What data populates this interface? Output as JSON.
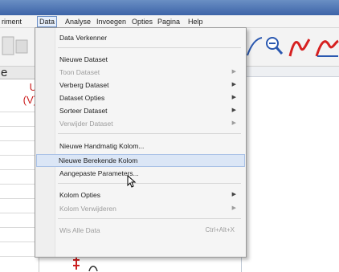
{
  "menubar": {
    "items": [
      {
        "id": "experiment",
        "label": "riment"
      },
      {
        "id": "data",
        "label": "Data"
      },
      {
        "id": "analyse",
        "label": "Analyse"
      },
      {
        "id": "invoegen",
        "label": "Invoegen"
      },
      {
        "id": "opties",
        "label": "Opties"
      },
      {
        "id": "pagina",
        "label": "Pagina"
      },
      {
        "id": "help",
        "label": "Help"
      }
    ]
  },
  "left_panel": {
    "header": "e",
    "label_line1": "U",
    "label_line2": "(V)"
  },
  "data_menu": {
    "items": [
      {
        "label": "Data Verkenner",
        "enabled": true,
        "submenu": false
      },
      {
        "label": "Nieuwe Dataset",
        "enabled": true,
        "submenu": false
      },
      {
        "label": "Toon Dataset",
        "enabled": false,
        "submenu": true
      },
      {
        "label": "Verberg Dataset",
        "enabled": true,
        "submenu": true
      },
      {
        "label": "Dataset Opties",
        "enabled": true,
        "submenu": true
      },
      {
        "label": "Sorteer Dataset",
        "enabled": true,
        "submenu": true
      },
      {
        "label": "Verwijder Dataset",
        "enabled": false,
        "submenu": true
      },
      {
        "label": "Nieuwe Handmatig Kolom...",
        "enabled": true,
        "submenu": false
      },
      {
        "label": "Nieuwe Berekende Kolom",
        "enabled": true,
        "submenu": false,
        "highlighted": true
      },
      {
        "label": "Aangepaste Parameters...",
        "enabled": true,
        "submenu": false
      },
      {
        "label": "Kolom Opties",
        "enabled": true,
        "submenu": true
      },
      {
        "label": "Kolom Verwijderen",
        "enabled": false,
        "submenu": true
      },
      {
        "label": "Wis Alle Data",
        "enabled": false,
        "submenu": false,
        "shortcut": "Ctrl+Alt+X"
      }
    ]
  },
  "colors": {
    "menu_highlight": "#dbe6f6",
    "accent_red": "#cc1f1f",
    "titlebar_blue": "#3d64a8"
  },
  "icons": [
    "zoom-out-icon",
    "curve-fit-icon",
    "graph-icon"
  ]
}
